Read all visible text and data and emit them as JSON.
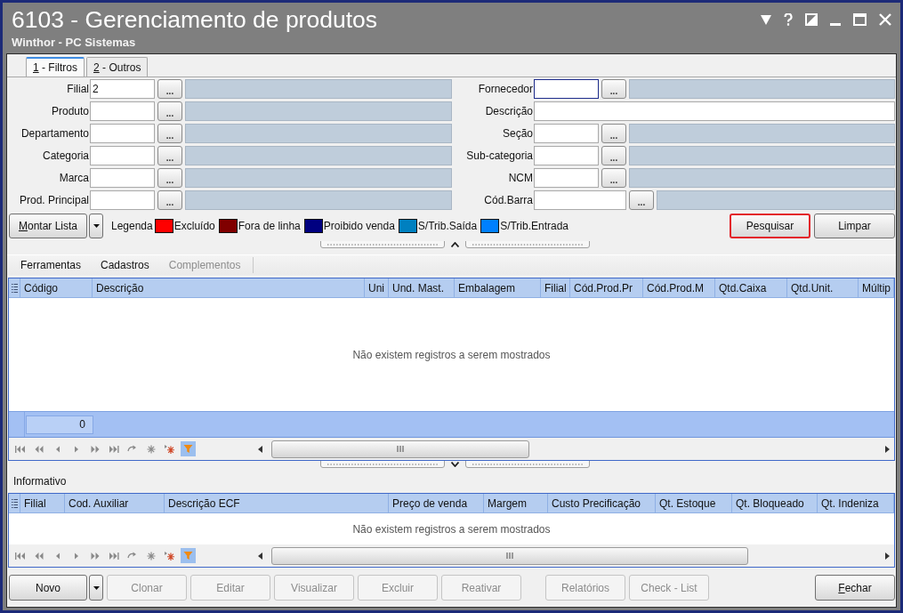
{
  "window": {
    "title": "6103 - Gerenciamento de produtos",
    "subtitle": "Winthor - PC Sistemas"
  },
  "tabs": [
    {
      "label": "1 - Filtros",
      "underline_first": true,
      "selected": true
    },
    {
      "label": "2 - Outros",
      "underline_first": true,
      "selected": false
    }
  ],
  "filters": {
    "left": [
      {
        "kind": "lookup",
        "label": "Filial",
        "value": "2",
        "button": "...",
        "focused": false
      },
      {
        "kind": "lookup",
        "label": "Produto",
        "button": "...",
        "focused": false
      },
      {
        "kind": "lookup",
        "label": "Departamento",
        "button": "...",
        "focused": false
      },
      {
        "kind": "lookup",
        "label": "Categoria",
        "button": "...",
        "focused": false
      },
      {
        "kind": "lookup",
        "label": "Marca",
        "button": "...",
        "focused": false
      },
      {
        "kind": "lookup",
        "label": "Prod. Principal",
        "button": "...",
        "focused": false
      }
    ],
    "right": [
      {
        "kind": "lookup",
        "label": "Fornecedor",
        "button": "...",
        "focused": true
      },
      {
        "kind": "text",
        "label": "Descrição",
        "focused": false
      },
      {
        "kind": "lookup",
        "label": "Seção",
        "button": "...",
        "focused": false
      },
      {
        "kind": "lookup",
        "label": "Sub-categoria",
        "button": "...",
        "focused": false
      },
      {
        "kind": "lookup",
        "label": "NCM",
        "button": "...",
        "focused": false
      },
      {
        "kind": "wide_lookup",
        "label": "Cód.Barra",
        "button": "...",
        "focused": false
      }
    ]
  },
  "montar_lista": {
    "label": "Montar Lista",
    "underline_first": true
  },
  "legend": {
    "title": "Legenda",
    "items": [
      {
        "label": "Excluído",
        "color": "#ff0000"
      },
      {
        "label": "Fora de linha",
        "color": "#800000"
      },
      {
        "label": "Proibido venda",
        "color": "#000080"
      },
      {
        "label": "S/Trib.Saída",
        "color": "#0080c0"
      },
      {
        "label": "S/Trib.Entrada",
        "color": "#0080ff"
      }
    ]
  },
  "search_buttons": [
    {
      "label": "Pesquisar",
      "highlighted": true
    },
    {
      "label": "Limpar",
      "highlighted": false
    }
  ],
  "menu": [
    {
      "label": "Ferramentas",
      "disabled": false
    },
    {
      "label": "Cadastros",
      "disabled": false
    },
    {
      "label": "Complementos",
      "disabled": true
    }
  ],
  "products_grid": {
    "columns": [
      "Código",
      "Descrição",
      "Uni",
      "Und. Mast.",
      "Embalagem",
      "Filial",
      "Cód.Prod.Pr",
      "Cód.Prod.M",
      "Qtd.Caixa",
      "Qtd.Unit.",
      "Múltip"
    ],
    "empty_message": "Não existem registros a serem mostrados",
    "summary": "0",
    "nav": {
      "filter_active": true
    }
  },
  "informativo": {
    "title": "Informativo",
    "grid": {
      "columns": [
        "Filial",
        "Cod. Auxiliar",
        "Descrição ECF",
        "Preço de venda",
        "Margem",
        "Custo Precificação",
        "Qt. Estoque",
        "Qt. Bloqueado",
        "Qt. Indeniza"
      ],
      "empty_message": "Não existem registros a serem mostrados",
      "nav": {
        "filter_active": true
      }
    }
  },
  "bottom_buttons": {
    "groups": [
      {
        "buttons": [
          {
            "label": "Novo",
            "kind": "split",
            "disabled": false,
            "underline_first": false
          },
          {
            "label": "Clonar",
            "kind": "plain",
            "disabled": true,
            "underline_first": false
          },
          {
            "label": "Editar",
            "kind": "plain",
            "disabled": true,
            "underline_first": false
          },
          {
            "label": "Visualizar",
            "kind": "plain",
            "disabled": true,
            "underline_first": false
          },
          {
            "label": "Excluir",
            "kind": "plain",
            "disabled": true,
            "underline_first": false
          },
          {
            "label": "Reativar",
            "kind": "plain",
            "disabled": true,
            "underline_first": false
          }
        ]
      },
      {
        "buttons": [
          {
            "label": "Relatórios",
            "kind": "plain",
            "disabled": true,
            "underline_first": false
          },
          {
            "label": "Check - List",
            "kind": "plain",
            "disabled": true,
            "underline_first": false
          }
        ]
      },
      {
        "buttons": [
          {
            "label": "Fechar",
            "kind": "plain",
            "disabled": false,
            "underline_first": true
          }
        ]
      }
    ]
  }
}
